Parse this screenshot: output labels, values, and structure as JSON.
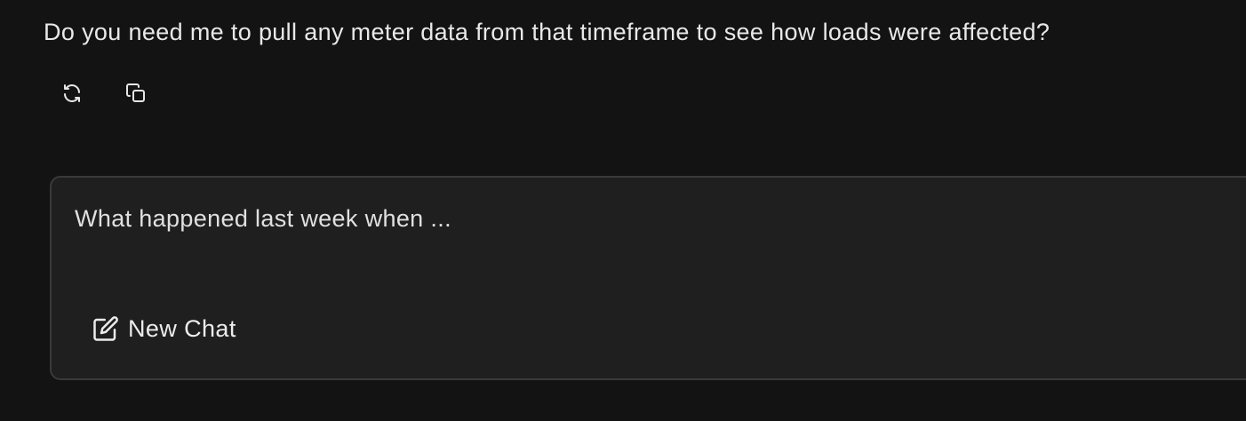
{
  "conversation": {
    "assistant_message": "Do you need me to pull any meter data from that timeframe to see how loads were affected?",
    "actions": [
      {
        "name": "regenerate",
        "icon": "refresh-icon"
      },
      {
        "name": "copy",
        "icon": "copy-icon"
      }
    ]
  },
  "composer": {
    "placeholder": "What happened last week when ...",
    "value": "",
    "new_chat_label": "New Chat",
    "new_chat_icon": "edit-icon"
  },
  "colors": {
    "background": "#131313",
    "composer_background": "#1f1f1f",
    "composer_border": "#3a3a3a",
    "text": "#e8e8e8"
  }
}
